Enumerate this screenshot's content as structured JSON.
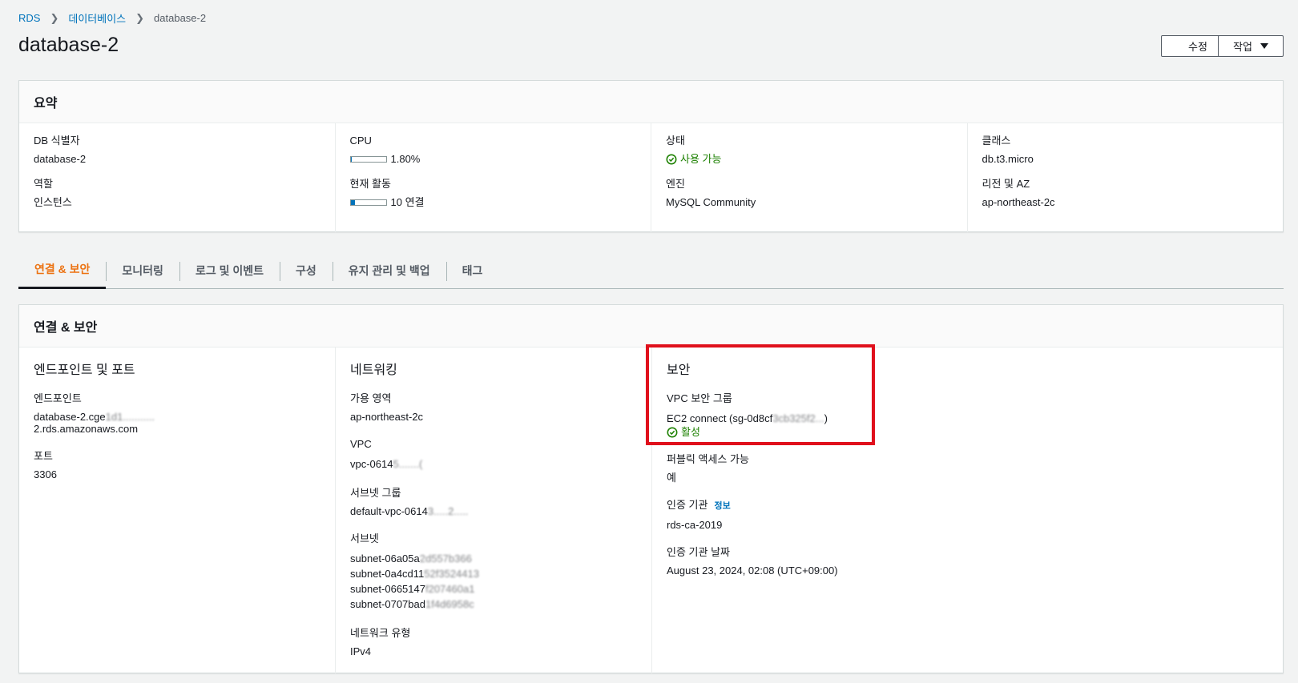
{
  "breadcrumb": {
    "root": "RDS",
    "databases": "데이터베이스",
    "current": "database-2"
  },
  "page_title": "database-2",
  "buttons": {
    "edit": "수정",
    "actions": "작업"
  },
  "summary": {
    "title": "요약",
    "db_identifier_label": "DB 식별자",
    "db_identifier": "database-2",
    "role_label": "역할",
    "role": "인스턴스",
    "cpu_label": "CPU",
    "cpu": "1.80%",
    "cpu_fraction": 0.018,
    "activity_label": "현재 활동",
    "activity": "10 연결",
    "activity_fraction": 0.12,
    "status_label": "상태",
    "status": "사용 가능",
    "engine_label": "엔진",
    "engine": "MySQL Community",
    "class_label": "클래스",
    "class": "db.t3.micro",
    "region_label": "리전 및 AZ",
    "region": "ap-northeast-2c"
  },
  "tabs": [
    "연결 & 보안",
    "모니터링",
    "로그 및 이벤트",
    "구성",
    "유지 관리 및 백업",
    "태그"
  ],
  "connectivity": {
    "title": "연결 & 보안",
    "endpoint_section": "엔드포인트 및 포트",
    "endpoint_label": "엔드포인트",
    "endpoint_line1": "database-2.cge",
    "endpoint_line1_obscured": "1d1...........",
    "endpoint_line2": "2.rds.amazonaws.com",
    "port_label": "포트",
    "port": "3306",
    "networking_section": "네트워킹",
    "az_label": "가용 영역",
    "az": "ap-northeast-2c",
    "vpc_label": "VPC",
    "vpc": "vpc-0614",
    "vpc_obscured": "5.......(",
    "subnet_group_label": "서브넷 그룹",
    "subnet_group": "default-vpc-0614",
    "subnet_group_obscured": "3.....2.....",
    "subnets_label": "서브넷",
    "subnets": [
      {
        "visible": "subnet-06a05a",
        "obscured": "2d557b366"
      },
      {
        "visible": "subnet-0a4cd11",
        "obscured": "52f3524413"
      },
      {
        "visible": "subnet-0665147",
        "obscured": "f207460a1"
      },
      {
        "visible": "subnet-0707bad",
        "obscured": "1f4d6958c"
      }
    ],
    "network_type_label": "네트워크 유형",
    "network_type": "IPv4",
    "security_section": "보안",
    "vpc_sg_label": "VPC 보안 그룹",
    "vpc_sg": "EC2 connect (sg-0d8cf",
    "vpc_sg_obscured": "3cb325f2...",
    "vpc_sg_end": ")",
    "vpc_sg_status": "활성",
    "public_access_label": "퍼블릭 액세스 가능",
    "public_access": "예",
    "ca_label": "인증 기관",
    "ca_info": "정보",
    "ca": "rds-ca-2019",
    "ca_date_label": "인증 기관 날짜",
    "ca_date": "August 23, 2024, 02:08 (UTC+09:00)"
  }
}
